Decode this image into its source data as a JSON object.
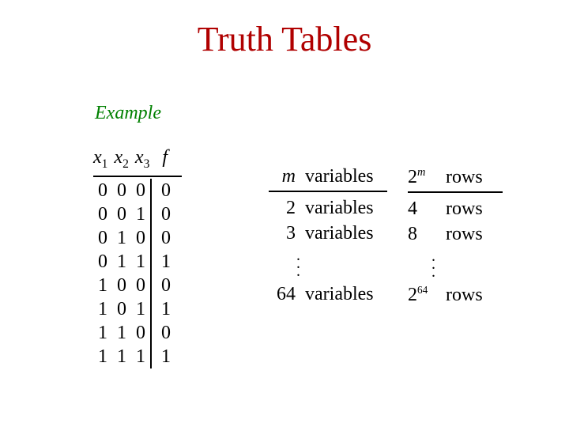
{
  "title": "Truth Tables",
  "example_label": "Example",
  "truth_table": {
    "headers": {
      "x1_var": "x",
      "x1_sub": "1",
      "x2_var": "x",
      "x2_sub": "2",
      "x3_var": "x",
      "x3_sub": "3",
      "f": "f"
    },
    "rows": [
      {
        "x1": "0",
        "x2": "0",
        "x3": "0",
        "f": "0"
      },
      {
        "x1": "0",
        "x2": "0",
        "x3": "1",
        "f": "0"
      },
      {
        "x1": "0",
        "x2": "1",
        "x3": "0",
        "f": "0"
      },
      {
        "x1": "0",
        "x2": "1",
        "x3": "1",
        "f": "1"
      },
      {
        "x1": "1",
        "x2": "0",
        "x3": "0",
        "f": "0"
      },
      {
        "x1": "1",
        "x2": "0",
        "x3": "1",
        "f": "1"
      },
      {
        "x1": "1",
        "x2": "1",
        "x3": "0",
        "f": "0"
      },
      {
        "x1": "1",
        "x2": "1",
        "x3": "1",
        "f": "1"
      }
    ]
  },
  "mapping": {
    "left_header": {
      "m": "m",
      "word": "variables"
    },
    "right_header": {
      "two": "2",
      "m": "m",
      "word": "rows"
    },
    "rows": [
      {
        "n": "2",
        "lword": "variables",
        "r": "4",
        "rword": "rows"
      },
      {
        "n": "3",
        "lword": "variables",
        "r": "8",
        "rword": "rows"
      }
    ],
    "final": {
      "n": "64",
      "lword": "variables",
      "r_base": "2",
      "r_exp": "64",
      "rword": "rows"
    }
  },
  "chart_data": {
    "type": "table",
    "title": "Truth Tables",
    "truth_table": {
      "columns": [
        "x1",
        "x2",
        "x3",
        "f"
      ],
      "rows": [
        [
          0,
          0,
          0,
          0
        ],
        [
          0,
          0,
          1,
          0
        ],
        [
          0,
          1,
          0,
          0
        ],
        [
          0,
          1,
          1,
          1
        ],
        [
          1,
          0,
          0,
          0
        ],
        [
          1,
          0,
          1,
          1
        ],
        [
          1,
          1,
          0,
          0
        ],
        [
          1,
          1,
          1,
          1
        ]
      ]
    },
    "variable_to_rows": [
      {
        "variables": 2,
        "rows": 4
      },
      {
        "variables": 3,
        "rows": 8
      },
      {
        "variables": 64,
        "rows": "2^64"
      }
    ],
    "general_rule": "m variables -> 2^m rows"
  }
}
